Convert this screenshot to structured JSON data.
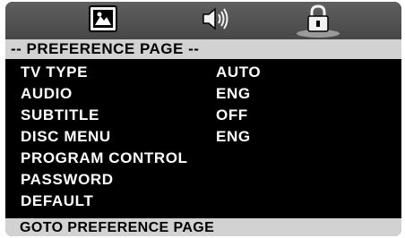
{
  "tabs": [
    {
      "icon": "video-settings-icon"
    },
    {
      "icon": "audio-speaker-icon"
    },
    {
      "icon": "lock-icon",
      "selected": true
    }
  ],
  "page": {
    "title": "-- PREFERENCE PAGE --"
  },
  "menu": {
    "items": [
      {
        "label": "TV TYPE",
        "value": "AUTO"
      },
      {
        "label": "AUDIO",
        "value": "ENG"
      },
      {
        "label": "SUBTITLE",
        "value": "OFF"
      },
      {
        "label": "DISC MENU",
        "value": "ENG"
      },
      {
        "label": "PROGRAM CONTROL"
      },
      {
        "label": "PASSWORD"
      },
      {
        "label": "DEFAULT"
      }
    ]
  },
  "status": {
    "text": "GOTO PREFERENCE PAGE"
  },
  "colors": {
    "background": "#000000",
    "bar": "#d2d2d2",
    "tab_strip": "#555555",
    "text": "#ffffff"
  }
}
